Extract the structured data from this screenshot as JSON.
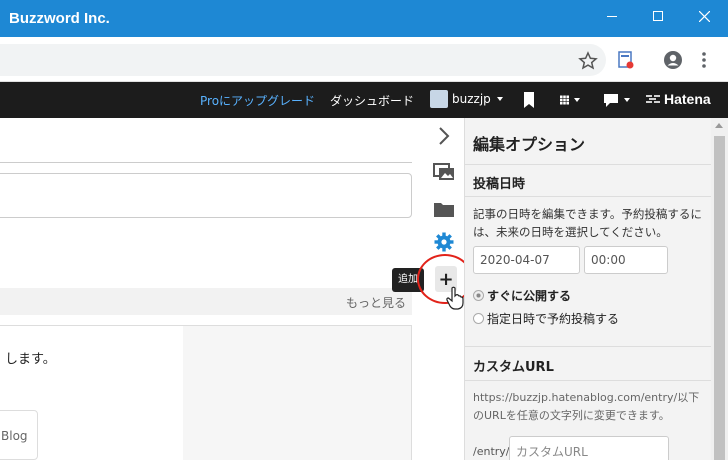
{
  "window": {
    "title": "Buzzword Inc."
  },
  "toolbar": {
    "upgrade_label": "Proにアップグレード",
    "dashboard_label": "ダッシュボード",
    "username": "buzzjp",
    "logo_text": "Hatena"
  },
  "editor": {
    "more_label": "もっと見る",
    "body_snippet": "します。",
    "chip_text": "Blog"
  },
  "rail": {
    "tooltip": "追加"
  },
  "panel": {
    "title": "編集オプション",
    "post_date": {
      "heading": "投稿日時",
      "description": "記事の日時を編集できます。予約投稿するには、未来の日時を選択してください。",
      "date_value": "2020-04-07",
      "time_value": "00:00",
      "option_publish_now": "すぐに公開する",
      "option_schedule": "指定日時で予約投稿する"
    },
    "custom_url": {
      "heading": "カスタムURL",
      "description": "https://buzzjp.hatenablog.com/entry/以下のURLを任意の文字列に変更できます。",
      "prefix": "/entry/",
      "placeholder": "カスタムURL"
    }
  },
  "colors": {
    "titlebar": "#1e88d4",
    "toolbar": "#1c1c1c",
    "upgrade_link": "#59b2ff",
    "gear": "#1e88d4",
    "highlight_circle": "#e2231a"
  }
}
